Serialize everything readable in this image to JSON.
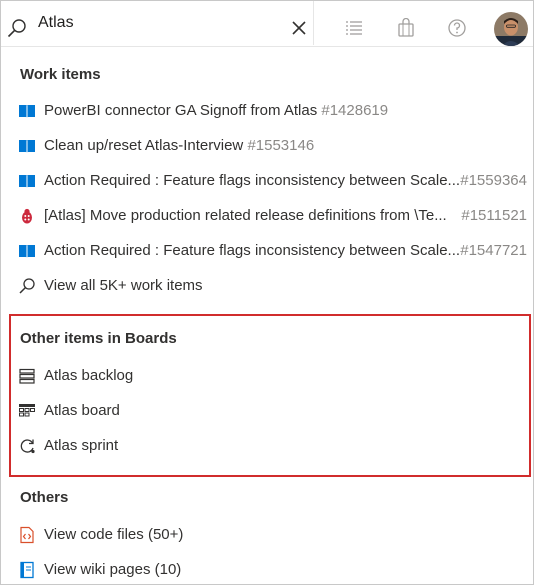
{
  "search": {
    "value": "Atlas"
  },
  "icons": {
    "search": "search-icon",
    "clear": "close-icon",
    "list": "checklist-icon",
    "bag": "marketplace-bag-icon",
    "help": "help-circle-icon",
    "avatar": "user-avatar"
  },
  "colors": {
    "book": "#0078d4",
    "bug": "#cc293d",
    "code": "#d94f2b",
    "wiki": "#0078d4",
    "highlight": "#d12c2c"
  },
  "work_items": {
    "title": "Work items",
    "items": [
      {
        "text": "PowerBI connector GA Signoff from Atlas",
        "id": "#1428619",
        "type": "book"
      },
      {
        "text": "Clean up/reset Atlas-Interview",
        "id": "#1553146",
        "type": "book"
      },
      {
        "text": "Action Required : Feature flags inconsistency between Scale...",
        "id": "#1559364",
        "type": "book"
      },
      {
        "text": "[Atlas] Move production related release definitions from \\Te...",
        "id": "#1511521",
        "type": "bug"
      },
      {
        "text": "Action Required : Feature flags inconsistency between Scale...",
        "id": "#1547721",
        "type": "book"
      }
    ],
    "view_all": "View all 5K+ work items"
  },
  "boards": {
    "title": "Other items in Boards",
    "items": [
      {
        "text": "Atlas backlog",
        "icon": "backlog-icon"
      },
      {
        "text": "Atlas board",
        "icon": "board-icon"
      },
      {
        "text": "Atlas sprint",
        "icon": "sprint-icon"
      }
    ]
  },
  "others": {
    "title": "Others",
    "items": [
      {
        "text": "View code files (50+)",
        "icon": "code-file-icon"
      },
      {
        "text": "View wiki pages (10)",
        "icon": "wiki-page-icon"
      }
    ]
  }
}
